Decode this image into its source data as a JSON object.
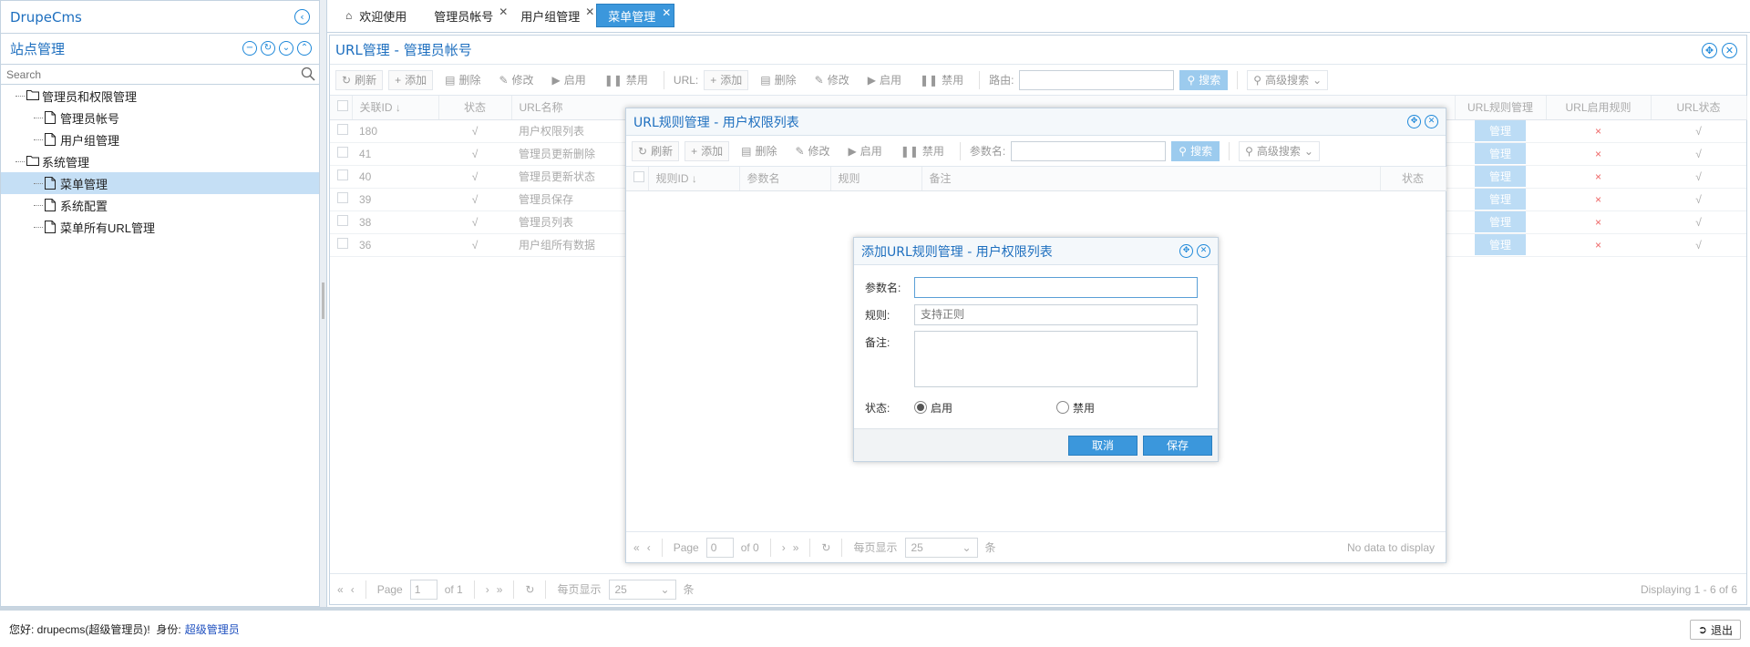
{
  "app": {
    "brand": "DrupeCms"
  },
  "sidebar": {
    "title": "站点管理",
    "search_placeholder": "Search",
    "tree": [
      {
        "label": "管理员和权限管理",
        "type": "folder",
        "level": 0
      },
      {
        "label": "管理员帐号",
        "type": "file",
        "level": 1
      },
      {
        "label": "用户组管理",
        "type": "file",
        "level": 1
      },
      {
        "label": "系统管理",
        "type": "folder",
        "level": 0
      },
      {
        "label": "菜单管理",
        "type": "file",
        "level": 1,
        "selected": true
      },
      {
        "label": "系统配置",
        "type": "file",
        "level": 1
      },
      {
        "label": "菜单所有URL管理",
        "type": "file",
        "level": 1
      }
    ]
  },
  "tabs": [
    {
      "label": "欢迎使用",
      "icon": "home-icon"
    },
    {
      "label": "管理员帐号",
      "closable": true
    },
    {
      "label": "用户组管理",
      "closable": true
    },
    {
      "label": "菜单管理",
      "closable": true,
      "active": true
    }
  ],
  "main": {
    "title": "URL管理 - 管理员帐号",
    "toolbar": {
      "refresh": "刷新",
      "add": "添加",
      "delete": "删除",
      "edit": "修改",
      "enable": "启用",
      "disable": "禁用",
      "url_label": "URL:",
      "add2": "添加",
      "delete2": "删除",
      "edit2": "修改",
      "enable2": "启用",
      "disable2": "禁用",
      "route_label": "路由:",
      "search": "搜索",
      "advanced": "高级搜索"
    },
    "columns": [
      "关联ID",
      "状态",
      "URL名称",
      "URL规则管理",
      "URL启用规则",
      "URL状态"
    ],
    "rows": [
      {
        "id": "180",
        "status": "√",
        "name": "用户权限列表",
        "manage": "管理",
        "rule": "×",
        "url_status": "√"
      },
      {
        "id": "41",
        "status": "√",
        "name": "管理员更新删除",
        "manage": "管理",
        "rule": "×",
        "url_status": "√"
      },
      {
        "id": "40",
        "status": "√",
        "name": "管理员更新状态",
        "manage": "管理",
        "rule": "×",
        "url_status": "√"
      },
      {
        "id": "39",
        "status": "√",
        "name": "管理员保存",
        "manage": "管理",
        "rule": "×",
        "url_status": "√"
      },
      {
        "id": "38",
        "status": "√",
        "name": "管理员列表",
        "manage": "管理",
        "rule": "×",
        "url_status": "√"
      },
      {
        "id": "36",
        "status": "√",
        "name": "用户组所有数据",
        "manage": "管理",
        "rule": "×",
        "url_status": "√"
      }
    ],
    "pager": {
      "page_label": "Page",
      "page": "1",
      "of": "of 1",
      "per_page_label": "每页显示",
      "per_page": "25",
      "unit": "条",
      "display": "Displaying 1 - 6 of 6"
    }
  },
  "dialog_rules": {
    "title": "URL规则管理 - 用户权限列表",
    "toolbar": {
      "refresh": "刷新",
      "add": "添加",
      "delete": "删除",
      "edit": "修改",
      "enable": "启用",
      "disable": "禁用",
      "param_label": "参数名:",
      "search": "搜索",
      "advanced": "高级搜索"
    },
    "columns": [
      "规则ID",
      "参数名",
      "规则",
      "备注",
      "状态"
    ],
    "pager": {
      "page_label": "Page",
      "page": "0",
      "of": "of 0",
      "per_page_label": "每页显示",
      "per_page": "25",
      "unit": "条",
      "display": "No data to display"
    }
  },
  "dialog_add": {
    "title": "添加URL规则管理 - 用户权限列表",
    "param_label": "参数名:",
    "param_value": "",
    "rule_label": "规则:",
    "rule_placeholder": "支持正则",
    "note_label": "备注:",
    "status_label": "状态:",
    "enable_label": "启用",
    "disable_label": "禁用",
    "cancel": "取消",
    "save": "保存"
  },
  "status_bar": {
    "greeting": "您好: drupecms(超级管理员)!  身份:",
    "role": "超级管理员",
    "logout": "退出"
  },
  "colors": {
    "accent": "#3b97dc",
    "title_blue": "#1e6fbf",
    "manage_btn": "#bcdcf5",
    "selected_row": "#c5dff5"
  }
}
